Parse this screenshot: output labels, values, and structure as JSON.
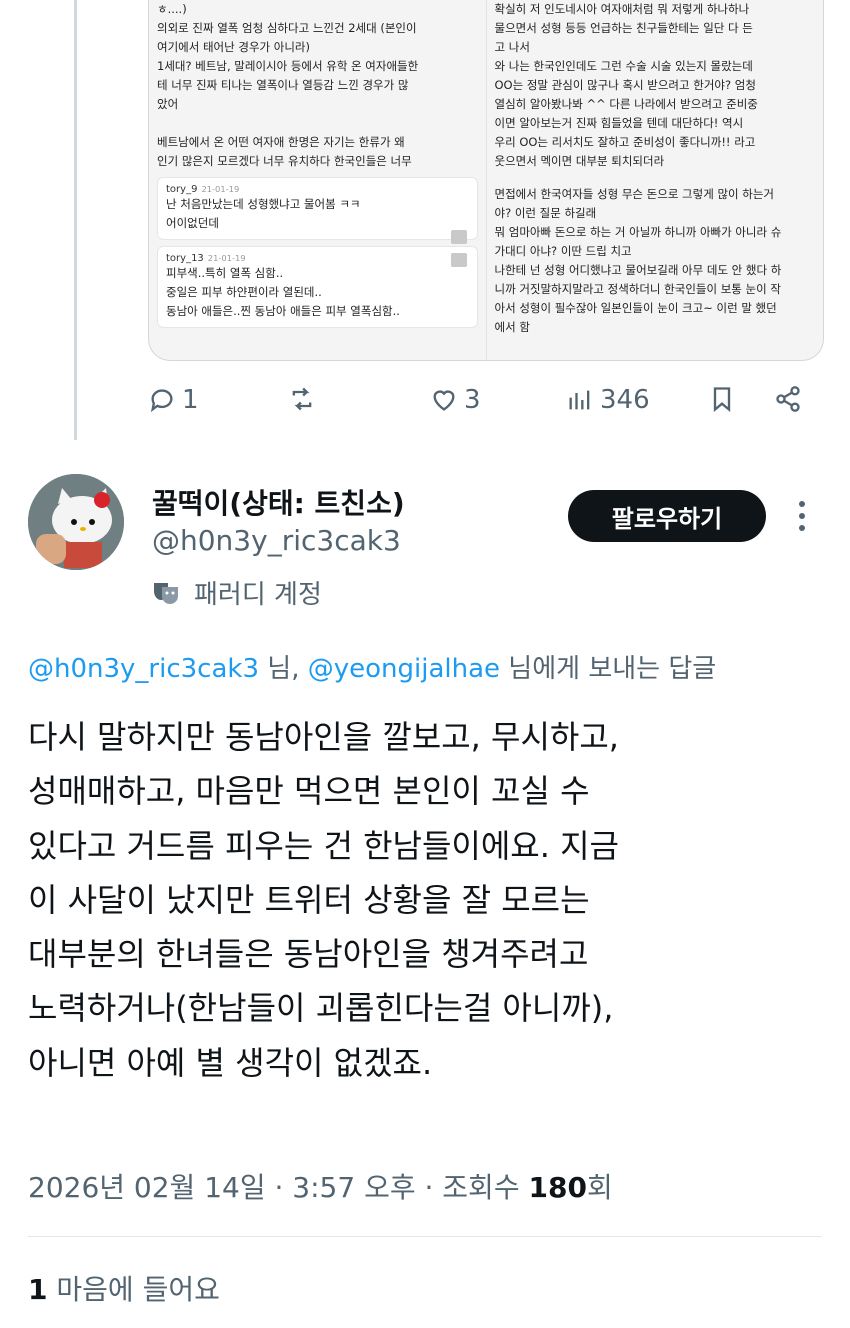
{
  "media": {
    "left_top_text": "ㅎ....)\n의외로 진짜 열폭 엄청 심하다고 느낀건 2세대 (본인이\n여기에서 태어난 경우가 아니라)\n1세대? 베트남, 말레이시아 등에서 유학 온 여자애들한\n테 너무 진짜 티나는 열폭이나 열등감 느낀 경우가 많\n았어\n\n베트남에서 온 어떤 여자애 한명은 자기는 한류가 왜\n인기 많은지 모르겠다 너무 유치하다 한국인들은 너무",
    "comments": [
      {
        "user": "tory_9",
        "date": "21-01-19",
        "text": "난 처음만났는데 성형했냐고 물어봄 ㅋㅋ\n어이없던데"
      },
      {
        "user": "tory_13",
        "date": "21-01-19",
        "text": "피부색..특히 열폭 심함..\n중일은 피부 하얀편이라 열된데..\n동남아 애들은..찐 동남아 애들은 피부 열폭심함.."
      }
    ],
    "right_top_text": "확실히 저 인도네시아 여자애처럼 뭐 저렇게 하나하나\n물으면서 성형 등등 언급하는 친구들한테는 일단 다 든\n고 나서\n와 나는 한국인인데도 그런 수술 시술 있는지 몰랐는데\nOO는 정말 관심이 많구나 혹시 받으려고 한거야? 엄청\n열심히 알아봤나봐 ^^ 다른 나라에서 받으려고 준비중\n이면 알아보는거 진짜 힘들었을 텐데 대단하다! 역시\n우리 OO는 리서치도 잘하고 준비성이 좋다니까!! 라고\n웃으면서 멕이면 대부분 퇴치되더라",
    "right_bottom_text": "면접에서 한국여자들 성형 무슨 돈으로 그렇게 많이 하는거\n야? 이런 질문 하길래\n뭐 엄마아빠 돈으로 하는 거 아닐까 하니까 아빠가 아니라 슈\n가대디 아냐? 이딴 드립 치고\n나한테 넌 성형 어디했냐고 물어보길래 아무 데도 안 했다 하\n니까 거짓말하지말라고 정색하더니 한국인들이 보통 눈이 작\n아서 성형이 필수잖아 일본인들이 눈이 크고~ 이런 말 했던\n에서 함"
  },
  "actions": {
    "reply_count": "1",
    "retweet_count": "",
    "like_count": "3",
    "view_count": "346"
  },
  "user": {
    "display_name": "꿀떡이(상태: 트친소)",
    "handle": "@h0n3y_ric3cak3",
    "parody_label": "패러디 계정",
    "follow_label": "팔로우하기"
  },
  "replying": {
    "mention1": "@h0n3y_ric3cak3",
    "suffix1": " 님, ",
    "mention2": "@yeongijalhae",
    "suffix2": " 님에게 보내는 답글"
  },
  "tweet_text": "다시 말하지만 동남아인을 깔보고, 무시하고,\n성매매하고, 마음만 먹으면 본인이 꼬실 수\n있다고 거드름 피우는 건 한남들이에요. 지금\n이 사달이 났지만 트위터 상황을 잘 모르는\n대부분의 한녀들은 동남아인을 챙겨주려고\n노력하거나(한남들이 괴롭힌다는걸 아니까),\n아니면 아예 별 생각이 없겠죠.",
  "meta": {
    "timestamp": "2026년 02월 14일 · 3:57 오후 · 조회수 ",
    "views": "180",
    "views_suffix": "회"
  },
  "likes": {
    "count": "1",
    "label": " 마음에 들어요"
  }
}
